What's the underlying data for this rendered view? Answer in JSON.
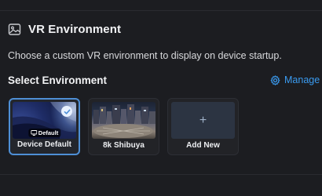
{
  "header": {
    "title": "VR Environment",
    "icon": "image-icon"
  },
  "description": "Choose a custom VR environment to display on device startup.",
  "select_section": {
    "title": "Select Environment",
    "manage_label": "Manage",
    "manage_icon": "gear-icon"
  },
  "environments": [
    {
      "label": "Device Default",
      "badge": "Default",
      "selected": true
    },
    {
      "label": "8k Shibuya",
      "selected": false
    },
    {
      "label": "Add New",
      "add_symbol": "+",
      "selected": false
    }
  ],
  "colors": {
    "accent": "#3a9bf0",
    "selected_border": "#4e8fd6",
    "background": "#1c1d21"
  }
}
